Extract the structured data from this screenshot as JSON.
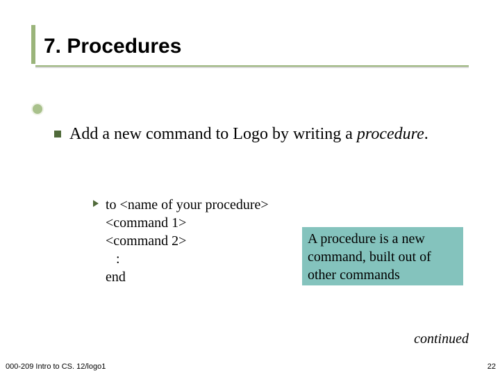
{
  "title": "7.  Procedures",
  "bullet": {
    "text_a": "Add a new command to Logo by writing a ",
    "text_b_italic": "procedure",
    "text_c": "."
  },
  "code": {
    "l1": "to <name of your procedure>",
    "l2": "<command 1>",
    "l3": "<command 2>",
    "l4": "   :",
    "l5": "end"
  },
  "callout": "A procedure is a new command, built out of other commands",
  "continued": "continued",
  "footer": "000-209 Intro to CS. 12/logo1",
  "page_number": "22"
}
